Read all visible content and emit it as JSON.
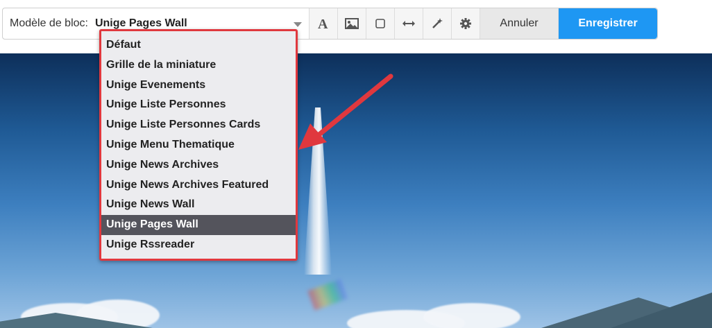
{
  "toolbar": {
    "template_label": "Modèle de bloc:",
    "template_value": "Unige Pages Wall",
    "tools": [
      {
        "icon": "text-style-icon"
      },
      {
        "icon": "image-icon"
      },
      {
        "icon": "box-icon"
      },
      {
        "icon": "width-icon"
      },
      {
        "icon": "magic-wand-icon"
      },
      {
        "icon": "gear-icon"
      }
    ],
    "cancel_label": "Annuler",
    "save_label": "Enregistrer",
    "save_color": "#1e97f3"
  },
  "dropdown": {
    "highlight_color": "#e0383e",
    "selected_index": 9,
    "options": [
      "Défaut",
      "Grille de la miniature",
      "Unige Evenements",
      "Unige Liste Personnes",
      "Unige Liste Personnes Cards",
      "Unige Menu Thematique",
      "Unige News Archives",
      "Unige News Archives Featured",
      "Unige News Wall",
      "Unige Pages Wall",
      "Unige Rssreader"
    ]
  }
}
